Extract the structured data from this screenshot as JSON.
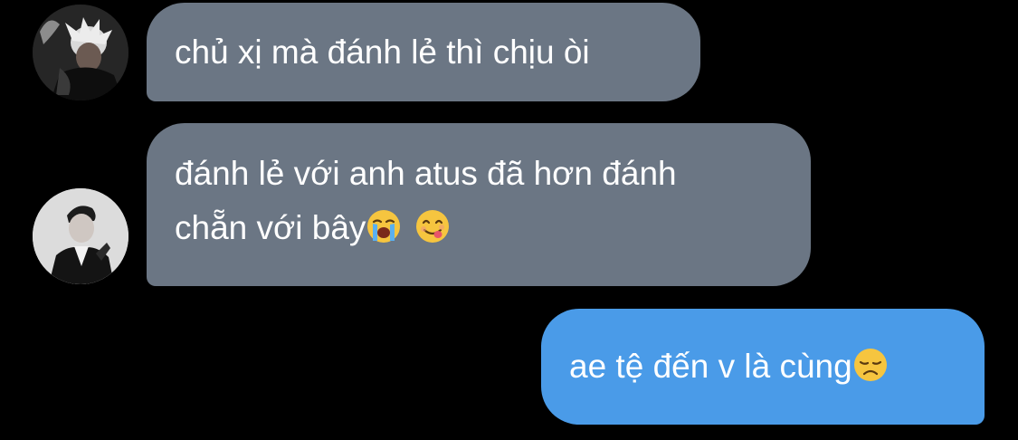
{
  "conversation": {
    "messages": [
      {
        "direction": "incoming",
        "lines": [
          "chủ xị mà đánh lẻ thì chịu òi"
        ],
        "avatar": "user-avatar-photo"
      },
      {
        "direction": "incoming",
        "lines": [
          "đánh lẻ với anh atus đã hơn đánh",
          "chẵn với bây"
        ],
        "emojis": [
          "loudly-crying-face-icon",
          "face-savoring-food-icon"
        ],
        "avatar": "user-avatar-photo"
      },
      {
        "direction": "outgoing",
        "lines": [
          "ae tệ đến v là cùng"
        ],
        "emojis": [
          "disappointed-face-icon"
        ]
      }
    ]
  },
  "colors": {
    "background": "#000000",
    "incoming_bubble": "#6b7684",
    "outgoing_bubble": "#4a9be8",
    "text": "#ffffff"
  }
}
